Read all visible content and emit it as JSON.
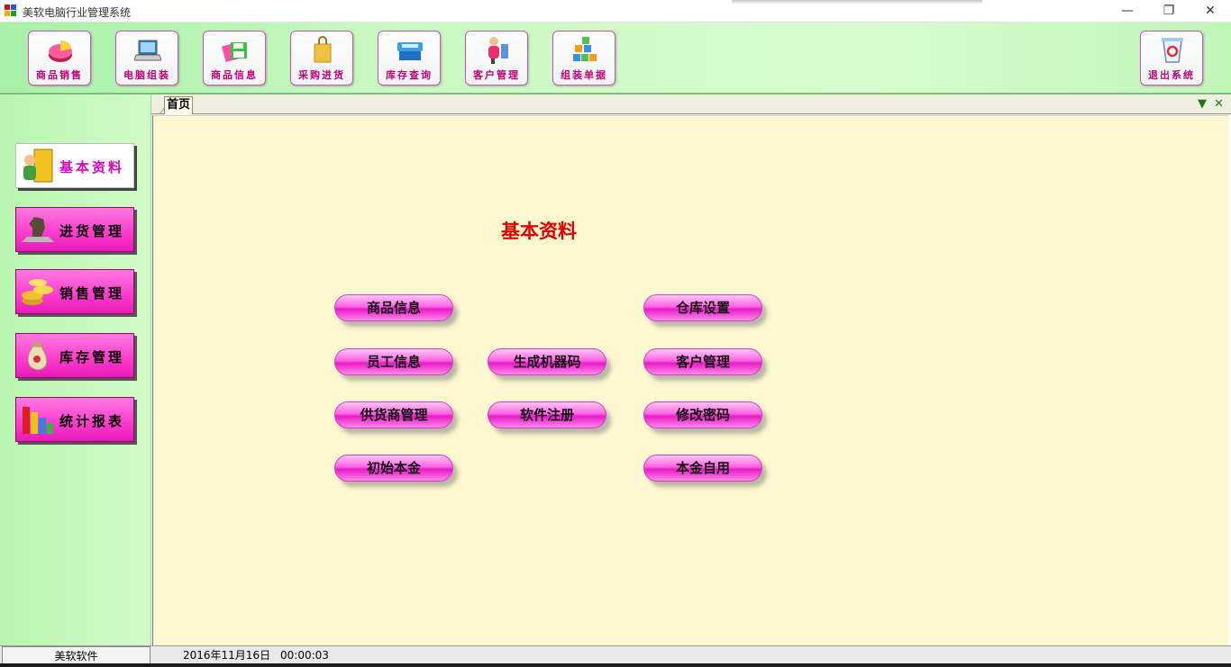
{
  "window": {
    "title": "美软电脑行业管理系统",
    "controls": [
      "minimize-icon",
      "restore-icon",
      "close-icon"
    ]
  },
  "toolbar": {
    "buttons": [
      {
        "label": "商品销售",
        "icon": "pie-chart-icon"
      },
      {
        "label": "电脑组装",
        "icon": "laptop-icon"
      },
      {
        "label": "商品信息",
        "icon": "floppy-disk-icon"
      },
      {
        "label": "采购进货",
        "icon": "shopping-bag-icon"
      },
      {
        "label": "库存查询",
        "icon": "cash-register-icon"
      },
      {
        "label": "客户管理",
        "icon": "customer-service-icon"
      },
      {
        "label": "组装单据",
        "icon": "cubes-icon"
      },
      {
        "label": "退出系统",
        "icon": "recycle-bin-icon"
      }
    ]
  },
  "sidebar": {
    "items": [
      {
        "label": "基本资料",
        "icon": "user-door-icon",
        "active": true
      },
      {
        "label": "进货管理",
        "icon": "chess-knight-icon",
        "active": false
      },
      {
        "label": "销售管理",
        "icon": "coins-icon",
        "active": false
      },
      {
        "label": "库存管理",
        "icon": "money-bag-icon",
        "active": false
      },
      {
        "label": "统计报表",
        "icon": "bar-chart-icon",
        "active": false
      }
    ]
  },
  "tabs": {
    "items": [
      {
        "label": "首页"
      }
    ],
    "controls": [
      "dropdown-arrow-icon",
      "close-tab-icon"
    ]
  },
  "main": {
    "heading": "基本资料",
    "buttons": [
      {
        "label": "商品信息"
      },
      {
        "label": "仓库设置"
      },
      {
        "label": "员工信息"
      },
      {
        "label": "生成机器码"
      },
      {
        "label": "客户管理"
      },
      {
        "label": "供货商管理"
      },
      {
        "label": "软件注册"
      },
      {
        "label": "修改密码"
      },
      {
        "label": "初始本金"
      },
      {
        "label": "本金自用"
      }
    ]
  },
  "statusbar": {
    "company": "美软软件",
    "date": "2016年11月16日",
    "time": "00:00:03"
  },
  "colors": {
    "accent_magenta": "#ff3fcf",
    "heading_red": "#e00000",
    "toolbar_green": "#c8f8c0",
    "content_bg": "#fef8d0"
  }
}
